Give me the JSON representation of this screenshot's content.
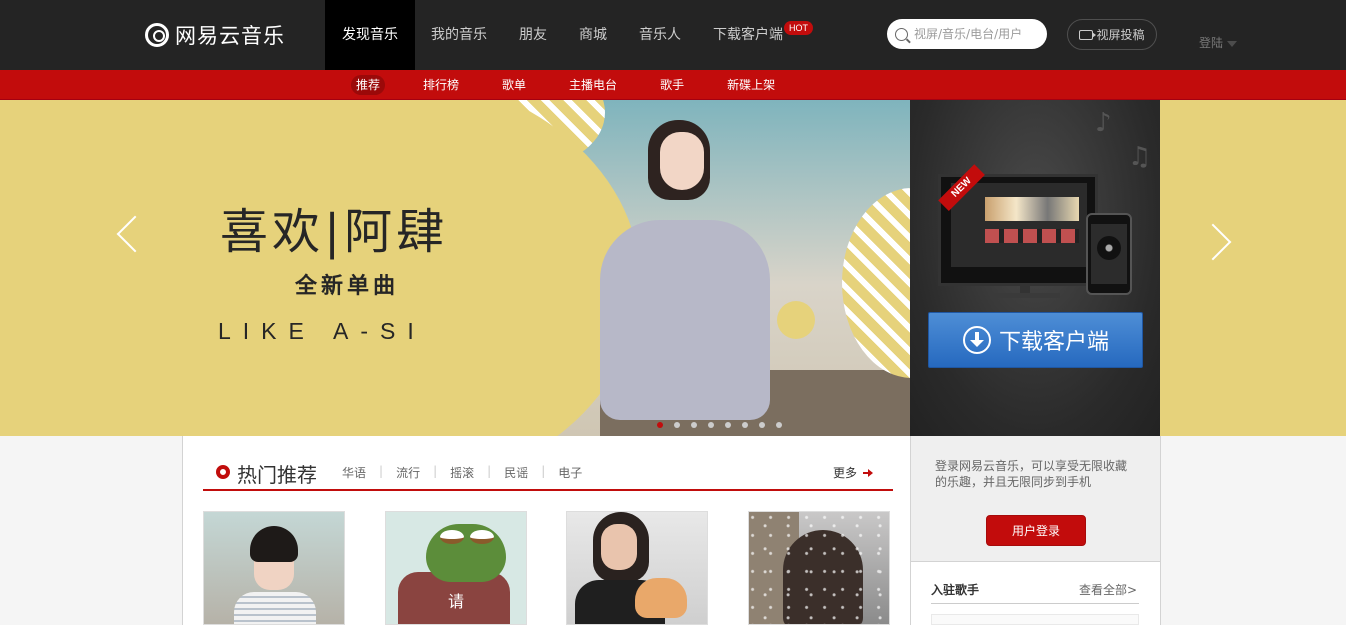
{
  "brand": {
    "name": "网易云音乐"
  },
  "nav": {
    "items": [
      {
        "label": "发现音乐"
      },
      {
        "label": "我的音乐"
      },
      {
        "label": "朋友"
      },
      {
        "label": "商城"
      },
      {
        "label": "音乐人"
      },
      {
        "label": "下载客户端",
        "badge": "HOT"
      }
    ]
  },
  "search": {
    "placeholder": "视屏/音乐/电台/用户"
  },
  "creator": {
    "label": "视屏投稿"
  },
  "login": {
    "label": "登陆"
  },
  "subnav": {
    "items": [
      {
        "label": "推荐"
      },
      {
        "label": "排行榜"
      },
      {
        "label": "歌单"
      },
      {
        "label": "主播电台"
      },
      {
        "label": "歌手"
      },
      {
        "label": "新碟上架"
      }
    ]
  },
  "banner": {
    "title": "喜欢|阿肆",
    "subtitle": "全新单曲",
    "english": "LIKE A-SI",
    "slide_count": 8,
    "active_slide": 1
  },
  "download": {
    "badge": "NEW",
    "button_label": "下载客户端"
  },
  "hot_recommend": {
    "title": "热门推荐",
    "tags": [
      "华语",
      "流行",
      "摇滚",
      "民谣",
      "电子"
    ],
    "more": "更多",
    "cover2_text": "请"
  },
  "sidebar": {
    "login_desc": "登录网易云音乐，可以享受无限收藏的乐趣，并且无限同步到手机",
    "login_button": "用户登录",
    "singers_title": "入驻歌手",
    "singers_all": "查看全部>"
  },
  "colors": {
    "brand_red": "#c20c0c",
    "topbar": "#242424",
    "banner_bg": "#e6d27b",
    "download_blue": "#2669bf"
  }
}
